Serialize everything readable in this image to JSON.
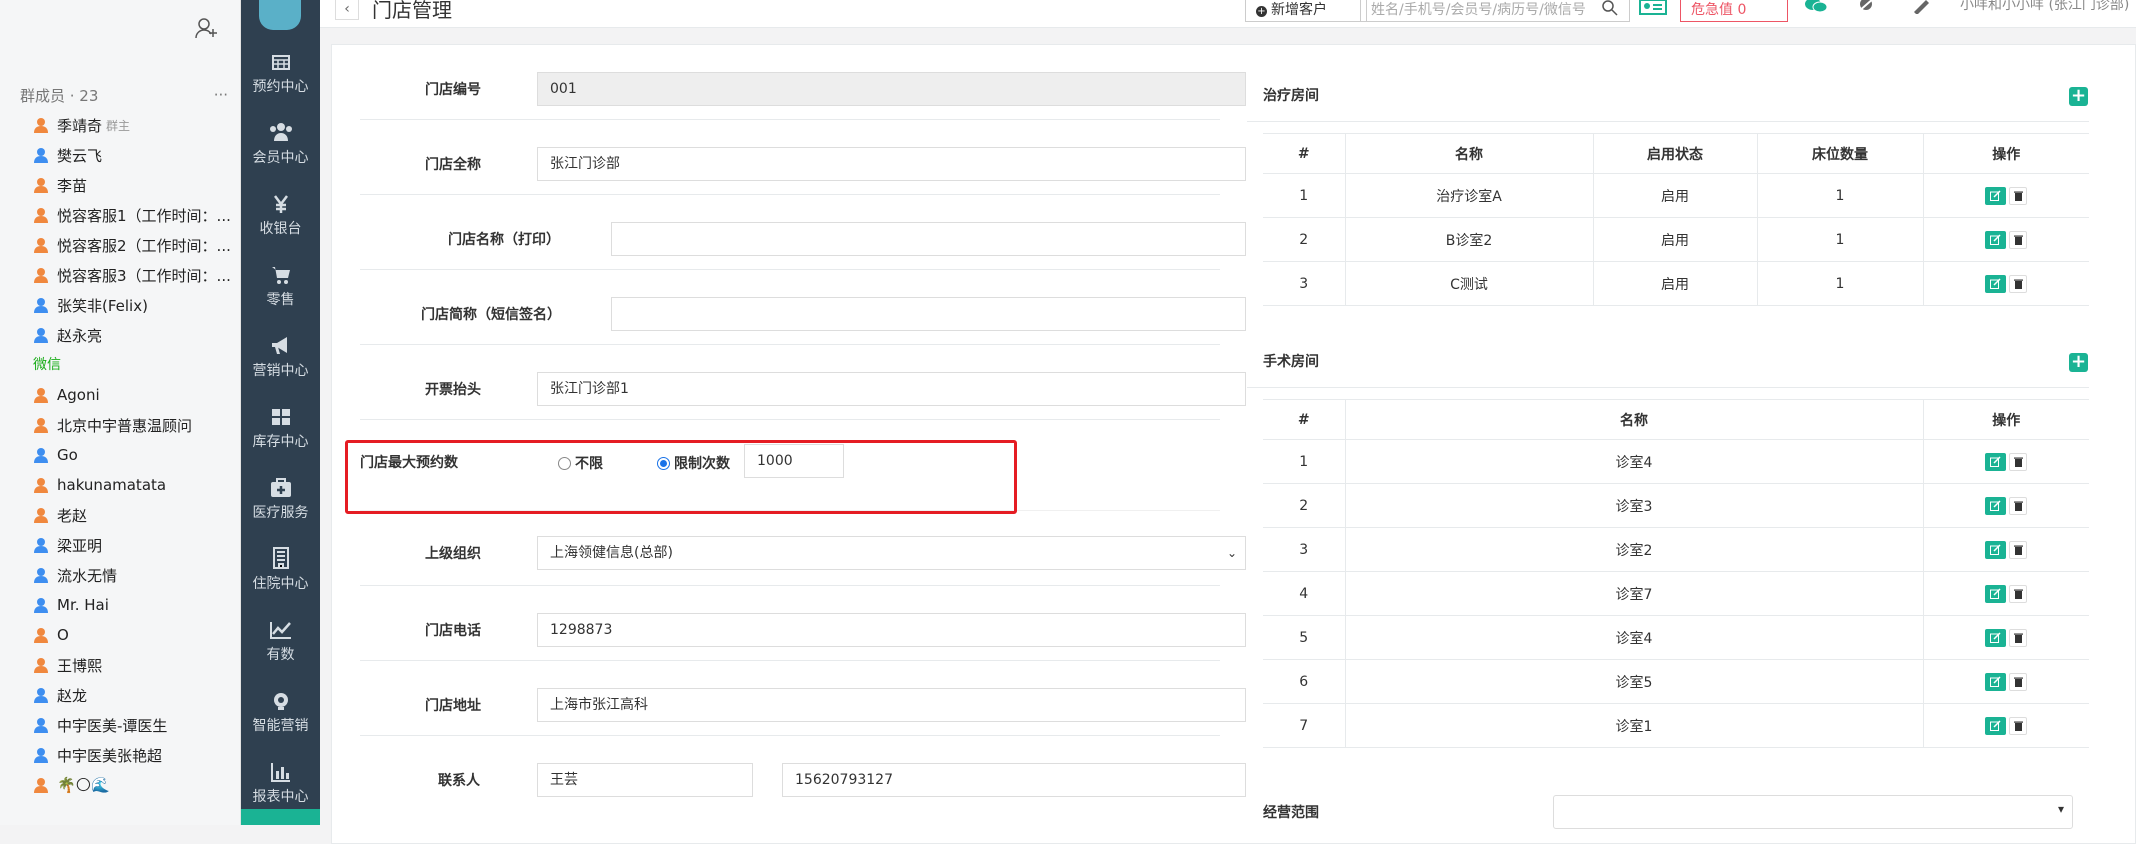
{
  "chat": {
    "members_title": "群成员 · 23",
    "more": "···",
    "owner_tag": "群主",
    "members": [
      {
        "name": "季靖奇",
        "color": "#f0883e"
      },
      {
        "name": "樊云飞",
        "color": "#3e8ef0"
      },
      {
        "name": "李苗",
        "color": "#f0883e"
      },
      {
        "name": "悦容客服1（工作时间：...",
        "color": "#f0883e"
      },
      {
        "name": "悦容客服2（工作时间：...",
        "color": "#f0883e"
      },
      {
        "name": "悦容客服3（工作时间：...",
        "color": "#f0883e"
      },
      {
        "name": "张笑非(Felix)",
        "color": "#3e8ef0"
      },
      {
        "name": "赵永亮",
        "color": "#3e8ef0"
      }
    ],
    "wechat_label": "微信",
    "wechat_members": [
      {
        "name": "Agoni",
        "color": "#f0883e"
      },
      {
        "name": "北京中宇普惠温顾问",
        "color": "#f0883e"
      },
      {
        "name": "Go",
        "color": "#3e8ef0"
      },
      {
        "name": "hakunamatata",
        "color": "#f0883e"
      },
      {
        "name": "老赵",
        "color": "#f0883e"
      },
      {
        "name": "梁亚明",
        "color": "#3e8ef0"
      },
      {
        "name": "流水无情",
        "color": "#3e8ef0"
      },
      {
        "name": "Mr. Hai",
        "color": "#3e8ef0"
      },
      {
        "name": "O",
        "color": "#f0883e"
      },
      {
        "name": "王博熙",
        "color": "#f0883e"
      },
      {
        "name": "赵龙",
        "color": "#3e8ef0"
      },
      {
        "name": "中宇医美-谭医生",
        "color": "#3e8ef0"
      },
      {
        "name": "中宇医美张艳超",
        "color": "#3e8ef0"
      },
      {
        "name": "🌴🌕🌊",
        "color": "#f0883e"
      }
    ]
  },
  "nav": [
    {
      "label": "预约中心",
      "icon": "calendar-icon"
    },
    {
      "label": "会员中心",
      "icon": "users-icon"
    },
    {
      "label": "收银台",
      "icon": "yen-icon"
    },
    {
      "label": "零售",
      "icon": "cart-icon"
    },
    {
      "label": "营销中心",
      "icon": "megaphone-icon"
    },
    {
      "label": "库存中心",
      "icon": "grid-icon"
    },
    {
      "label": "医疗服务",
      "icon": "medkit-icon"
    },
    {
      "label": "住院中心",
      "icon": "building-icon"
    },
    {
      "label": "有数",
      "icon": "chart-line-icon"
    },
    {
      "label": "智能营销",
      "icon": "bulb-icon"
    },
    {
      "label": "报表中心",
      "icon": "bar-chart-icon"
    }
  ],
  "topbar": {
    "back": "‹",
    "title": "门店管理",
    "new_customer": "新增客户",
    "search_placeholder": "姓名/手机号/会员号/病历号/微信号",
    "alert": "危急值 0",
    "user": "小咩和小小咩 (张江门诊部)"
  },
  "form": {
    "store_no_label": "门店编号",
    "store_no": "001",
    "full_name_label": "门店全称",
    "full_name": "张江门诊部",
    "print_name_label": "门店名称（打印）",
    "print_name": "",
    "short_name_label": "门店简称（短信签名）",
    "short_name": "",
    "invoice_label": "开票抬头",
    "invoice": "张江门诊部1",
    "max_booking_label": "门店最大预约数",
    "unlimited": "不限",
    "limited": "限制次数",
    "limit_count": "1000",
    "parent_org_label": "上级组织",
    "parent_org": "上海领健信息(总部)",
    "phone_label": "门店电话",
    "phone": "1298873",
    "address_label": "门店地址",
    "address": "上海市张江高科",
    "contact_label": "联系人",
    "contact_name": "王芸",
    "contact_phone": "15620793127"
  },
  "treatment": {
    "title": "治疗房间",
    "headers": [
      "#",
      "名称",
      "启用状态",
      "床位数量",
      "操作"
    ],
    "rows": [
      [
        "1",
        "治疗诊室A",
        "启用",
        "1"
      ],
      [
        "2",
        "B诊室2",
        "启用",
        "1"
      ],
      [
        "3",
        "C测试",
        "启用",
        "1"
      ]
    ]
  },
  "surgery": {
    "title": "手术房间",
    "headers": [
      "#",
      "名称",
      "操作"
    ],
    "rows": [
      [
        "1",
        "诊室4"
      ],
      [
        "2",
        "诊室3"
      ],
      [
        "3",
        "诊室2"
      ],
      [
        "4",
        "诊室7"
      ],
      [
        "5",
        "诊室4"
      ],
      [
        "6",
        "诊室5"
      ],
      [
        "7",
        "诊室1"
      ]
    ]
  },
  "scope_label": "经营范围",
  "colors": {
    "accent": "#1ab394",
    "nav_bg": "#2f4050",
    "danger": "#e51c23"
  }
}
